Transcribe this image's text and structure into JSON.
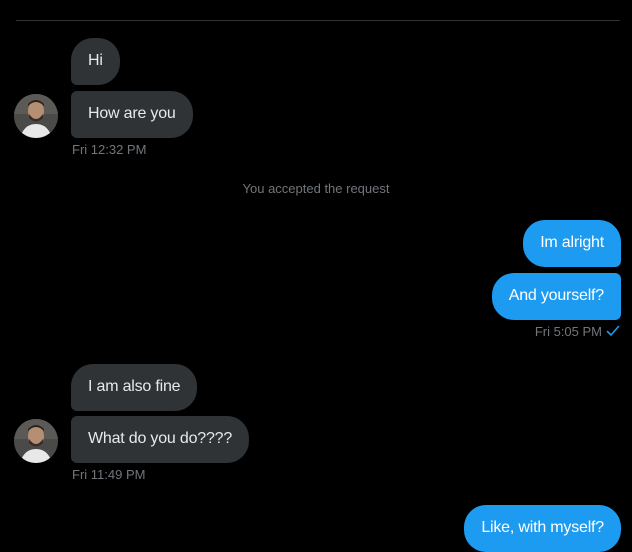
{
  "colors": {
    "background": "#000000",
    "incoming_bubble": "#2f3336",
    "outgoing_bubble": "#1d9bf0",
    "timestamp": "#71767b",
    "divider": "#2f3336"
  },
  "conversation": {
    "group1": {
      "messages": [
        "Hi",
        "How are you"
      ],
      "timestamp": "Fri 12:32 PM"
    },
    "system_notice": "You accepted the request",
    "group2": {
      "messages": [
        "Im alright",
        "And yourself?"
      ],
      "timestamp": "Fri 5:05 PM",
      "status_icon": "checkmark-icon"
    },
    "group3": {
      "messages": [
        "I am also fine",
        "What do you do????"
      ],
      "timestamp": "Fri 11:49 PM"
    },
    "group4": {
      "messages": [
        "Like, with myself?"
      ]
    }
  },
  "icons": {
    "avatar": "user-avatar",
    "read_status": "checkmark-icon"
  }
}
